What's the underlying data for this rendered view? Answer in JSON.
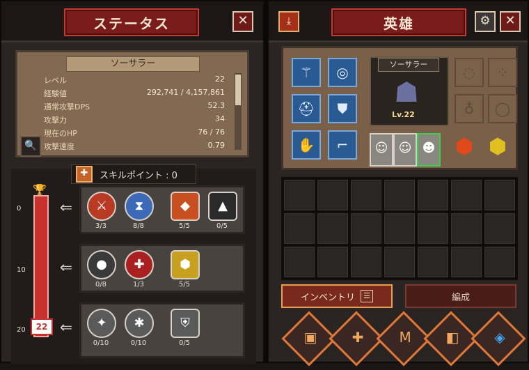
{
  "status_panel": {
    "title": "ステータス",
    "close_glyph": "✕",
    "class_name": "ソーサラー",
    "stats": [
      {
        "label": "レベル",
        "value": "22"
      },
      {
        "label": "経験値",
        "value": "292,741 / 4,157,861"
      },
      {
        "label": "通常攻撃DPS",
        "value": "52.3"
      },
      {
        "label": "攻撃力",
        "value": "34"
      },
      {
        "label": "現在のHP",
        "value": "76 / 76"
      },
      {
        "label": "攻撃速度",
        "value": "0.79"
      }
    ],
    "skill_points_label": "スキルポイント : 0",
    "gauge_marks": [
      "0",
      "10",
      "20"
    ],
    "gauge_badge": "22",
    "tiers": [
      {
        "skills": [
          {
            "icon": "sword-slash-icon",
            "glyph": "⚔",
            "count": "3/3",
            "color": "#b83a22"
          },
          {
            "icon": "hourglass-icon",
            "glyph": "⧗",
            "count": "8/8",
            "color": "#3a6ab8"
          },
          {
            "icon": "fire-gem-icon",
            "glyph": "◆",
            "count": "5/5",
            "color": "#c85020"
          },
          {
            "icon": "arrowhead-icon",
            "glyph": "▲",
            "count": "0/5",
            "color": "#2a2a2a"
          }
        ]
      },
      {
        "skills": [
          {
            "icon": "black-orb-icon",
            "glyph": "●",
            "count": "0/8",
            "color": "#3a3a3a"
          },
          {
            "icon": "red-cross-shield-icon",
            "glyph": "✚",
            "count": "1/3",
            "color": "#a82020"
          },
          {
            "icon": "gold-coins-icon",
            "glyph": "⬢",
            "count": "5/5",
            "color": "#c8a020"
          }
        ]
      },
      {
        "skills": [
          {
            "icon": "gray-rune-icon",
            "glyph": "✦",
            "count": "0/10",
            "color": "#5a5a5a"
          },
          {
            "icon": "gray-vortex-icon",
            "glyph": "✱",
            "count": "0/10",
            "color": "#5a5a5a"
          },
          {
            "icon": "gray-helm-icon",
            "glyph": "⛨",
            "count": "0/5",
            "color": "#5a5a5a"
          }
        ]
      }
    ]
  },
  "hero_panel": {
    "title": "英雄",
    "close_glyph": "✕",
    "hero_name": "ソーサラー",
    "level_prefix": "Lv.",
    "level": "22",
    "tabs": {
      "inventory": "インベントリ",
      "formation": "編成",
      "menu_glyph": "☰"
    },
    "bottom_buttons": [
      {
        "icon": "chest-icon",
        "glyph": "▣"
      },
      {
        "icon": "cross-emblem-icon",
        "glyph": "✚"
      },
      {
        "icon": "rune-m-icon",
        "glyph": "M"
      },
      {
        "icon": "box-icon",
        "glyph": "◧"
      },
      {
        "icon": "blue-gem-icon",
        "glyph": "◈"
      }
    ]
  }
}
